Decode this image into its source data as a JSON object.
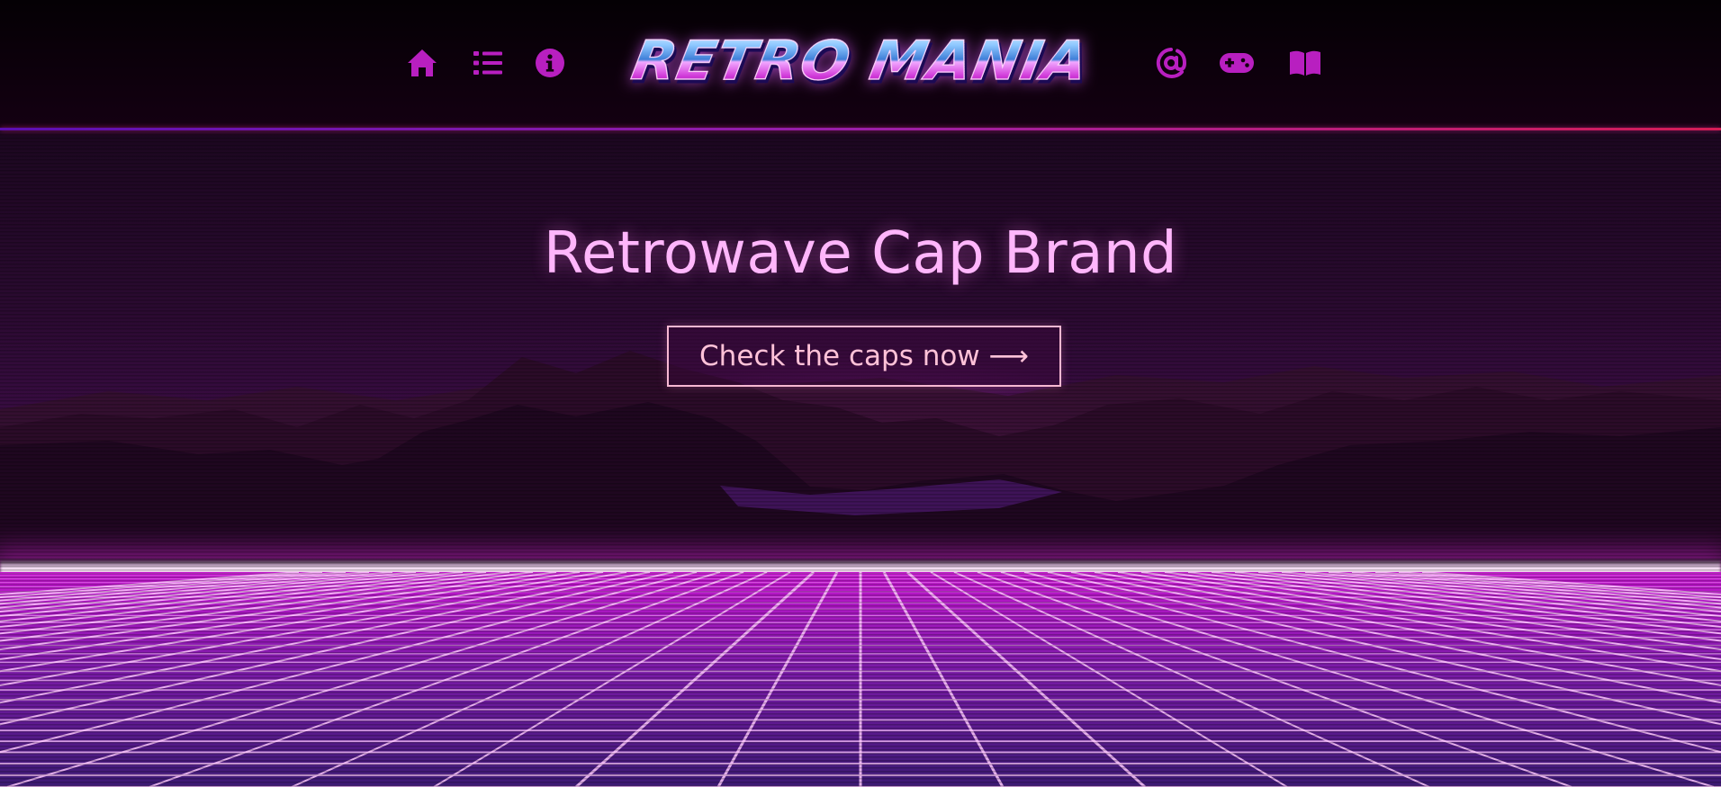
{
  "header": {
    "logo_text": "RETRO MANIA",
    "left_icons": [
      "home-icon",
      "list-icon",
      "info-icon"
    ],
    "right_icons": [
      "at-sign-icon",
      "gamepad-icon",
      "book-icon"
    ]
  },
  "hero": {
    "title": "Retrowave Cap Brand",
    "cta_label": "Check the caps now ⟶"
  },
  "colors": {
    "icon": "#b81fc0",
    "title": "#ffb6fb",
    "cta_border": "#f7b8d2",
    "header_line_start": "#5b0fb0",
    "header_line_end": "#d41d55",
    "grid_line": "#ffc8ff"
  }
}
